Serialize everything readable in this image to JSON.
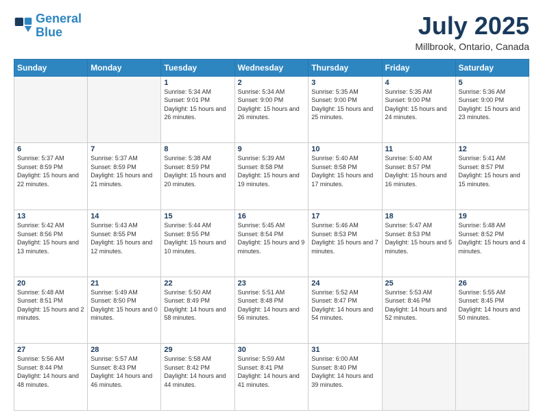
{
  "logo": {
    "line1": "General",
    "line2": "Blue"
  },
  "title": "July 2025",
  "location": "Millbrook, Ontario, Canada",
  "headers": [
    "Sunday",
    "Monday",
    "Tuesday",
    "Wednesday",
    "Thursday",
    "Friday",
    "Saturday"
  ],
  "weeks": [
    [
      {
        "num": "",
        "sunrise": "",
        "sunset": "",
        "daylight": ""
      },
      {
        "num": "",
        "sunrise": "",
        "sunset": "",
        "daylight": ""
      },
      {
        "num": "1",
        "sunrise": "Sunrise: 5:34 AM",
        "sunset": "Sunset: 9:01 PM",
        "daylight": "Daylight: 15 hours and 26 minutes."
      },
      {
        "num": "2",
        "sunrise": "Sunrise: 5:34 AM",
        "sunset": "Sunset: 9:00 PM",
        "daylight": "Daylight: 15 hours and 26 minutes."
      },
      {
        "num": "3",
        "sunrise": "Sunrise: 5:35 AM",
        "sunset": "Sunset: 9:00 PM",
        "daylight": "Daylight: 15 hours and 25 minutes."
      },
      {
        "num": "4",
        "sunrise": "Sunrise: 5:35 AM",
        "sunset": "Sunset: 9:00 PM",
        "daylight": "Daylight: 15 hours and 24 minutes."
      },
      {
        "num": "5",
        "sunrise": "Sunrise: 5:36 AM",
        "sunset": "Sunset: 9:00 PM",
        "daylight": "Daylight: 15 hours and 23 minutes."
      }
    ],
    [
      {
        "num": "6",
        "sunrise": "Sunrise: 5:37 AM",
        "sunset": "Sunset: 8:59 PM",
        "daylight": "Daylight: 15 hours and 22 minutes."
      },
      {
        "num": "7",
        "sunrise": "Sunrise: 5:37 AM",
        "sunset": "Sunset: 8:59 PM",
        "daylight": "Daylight: 15 hours and 21 minutes."
      },
      {
        "num": "8",
        "sunrise": "Sunrise: 5:38 AM",
        "sunset": "Sunset: 8:59 PM",
        "daylight": "Daylight: 15 hours and 20 minutes."
      },
      {
        "num": "9",
        "sunrise": "Sunrise: 5:39 AM",
        "sunset": "Sunset: 8:58 PM",
        "daylight": "Daylight: 15 hours and 19 minutes."
      },
      {
        "num": "10",
        "sunrise": "Sunrise: 5:40 AM",
        "sunset": "Sunset: 8:58 PM",
        "daylight": "Daylight: 15 hours and 17 minutes."
      },
      {
        "num": "11",
        "sunrise": "Sunrise: 5:40 AM",
        "sunset": "Sunset: 8:57 PM",
        "daylight": "Daylight: 15 hours and 16 minutes."
      },
      {
        "num": "12",
        "sunrise": "Sunrise: 5:41 AM",
        "sunset": "Sunset: 8:57 PM",
        "daylight": "Daylight: 15 hours and 15 minutes."
      }
    ],
    [
      {
        "num": "13",
        "sunrise": "Sunrise: 5:42 AM",
        "sunset": "Sunset: 8:56 PM",
        "daylight": "Daylight: 15 hours and 13 minutes."
      },
      {
        "num": "14",
        "sunrise": "Sunrise: 5:43 AM",
        "sunset": "Sunset: 8:55 PM",
        "daylight": "Daylight: 15 hours and 12 minutes."
      },
      {
        "num": "15",
        "sunrise": "Sunrise: 5:44 AM",
        "sunset": "Sunset: 8:55 PM",
        "daylight": "Daylight: 15 hours and 10 minutes."
      },
      {
        "num": "16",
        "sunrise": "Sunrise: 5:45 AM",
        "sunset": "Sunset: 8:54 PM",
        "daylight": "Daylight: 15 hours and 9 minutes."
      },
      {
        "num": "17",
        "sunrise": "Sunrise: 5:46 AM",
        "sunset": "Sunset: 8:53 PM",
        "daylight": "Daylight: 15 hours and 7 minutes."
      },
      {
        "num": "18",
        "sunrise": "Sunrise: 5:47 AM",
        "sunset": "Sunset: 8:53 PM",
        "daylight": "Daylight: 15 hours and 5 minutes."
      },
      {
        "num": "19",
        "sunrise": "Sunrise: 5:48 AM",
        "sunset": "Sunset: 8:52 PM",
        "daylight": "Daylight: 15 hours and 4 minutes."
      }
    ],
    [
      {
        "num": "20",
        "sunrise": "Sunrise: 5:48 AM",
        "sunset": "Sunset: 8:51 PM",
        "daylight": "Daylight: 15 hours and 2 minutes."
      },
      {
        "num": "21",
        "sunrise": "Sunrise: 5:49 AM",
        "sunset": "Sunset: 8:50 PM",
        "daylight": "Daylight: 15 hours and 0 minutes."
      },
      {
        "num": "22",
        "sunrise": "Sunrise: 5:50 AM",
        "sunset": "Sunset: 8:49 PM",
        "daylight": "Daylight: 14 hours and 58 minutes."
      },
      {
        "num": "23",
        "sunrise": "Sunrise: 5:51 AM",
        "sunset": "Sunset: 8:48 PM",
        "daylight": "Daylight: 14 hours and 56 minutes."
      },
      {
        "num": "24",
        "sunrise": "Sunrise: 5:52 AM",
        "sunset": "Sunset: 8:47 PM",
        "daylight": "Daylight: 14 hours and 54 minutes."
      },
      {
        "num": "25",
        "sunrise": "Sunrise: 5:53 AM",
        "sunset": "Sunset: 8:46 PM",
        "daylight": "Daylight: 14 hours and 52 minutes."
      },
      {
        "num": "26",
        "sunrise": "Sunrise: 5:55 AM",
        "sunset": "Sunset: 8:45 PM",
        "daylight": "Daylight: 14 hours and 50 minutes."
      }
    ],
    [
      {
        "num": "27",
        "sunrise": "Sunrise: 5:56 AM",
        "sunset": "Sunset: 8:44 PM",
        "daylight": "Daylight: 14 hours and 48 minutes."
      },
      {
        "num": "28",
        "sunrise": "Sunrise: 5:57 AM",
        "sunset": "Sunset: 8:43 PM",
        "daylight": "Daylight: 14 hours and 46 minutes."
      },
      {
        "num": "29",
        "sunrise": "Sunrise: 5:58 AM",
        "sunset": "Sunset: 8:42 PM",
        "daylight": "Daylight: 14 hours and 44 minutes."
      },
      {
        "num": "30",
        "sunrise": "Sunrise: 5:59 AM",
        "sunset": "Sunset: 8:41 PM",
        "daylight": "Daylight: 14 hours and 41 minutes."
      },
      {
        "num": "31",
        "sunrise": "Sunrise: 6:00 AM",
        "sunset": "Sunset: 8:40 PM",
        "daylight": "Daylight: 14 hours and 39 minutes."
      },
      {
        "num": "",
        "sunrise": "",
        "sunset": "",
        "daylight": ""
      },
      {
        "num": "",
        "sunrise": "",
        "sunset": "",
        "daylight": ""
      }
    ]
  ]
}
